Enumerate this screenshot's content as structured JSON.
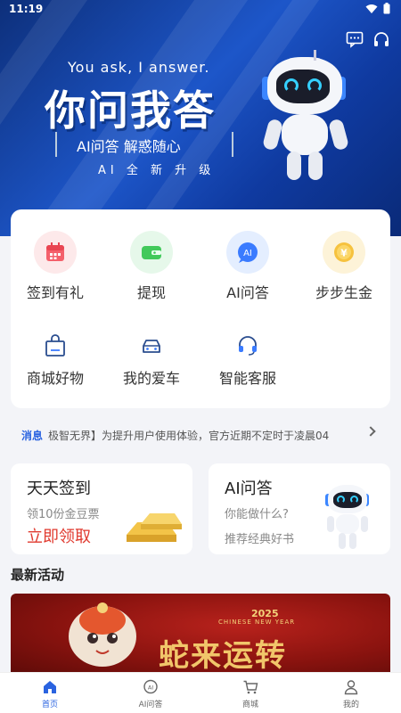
{
  "status_bar": {
    "time": "11:19"
  },
  "hero": {
    "slogan_en": "You ask, I answer.",
    "slogan_cn": "你问我答",
    "sub_title": "AI问答 解惑随心",
    "upgrade": "AI 全 新 升 级"
  },
  "menu": {
    "items": [
      {
        "label": "签到有礼",
        "icon": "calendar-gift-icon"
      },
      {
        "label": "提现",
        "icon": "withdraw-wallet-icon"
      },
      {
        "label": "AI问答",
        "icon": "ai-chat-icon"
      },
      {
        "label": "步步生金",
        "icon": "gold-coin-icon"
      },
      {
        "label": "商城好物",
        "icon": "shopping-bag-icon"
      },
      {
        "label": "我的爱车",
        "icon": "car-icon"
      },
      {
        "label": "智能客服",
        "icon": "headset-icon"
      }
    ]
  },
  "notice": {
    "tag": "消息",
    "text": "极智无界】为提升用户使用体验，官方近期不定时于凌晨04"
  },
  "cards": {
    "sign_in": {
      "title": "天天签到",
      "subtitle": "领10份金豆票",
      "cta": "立即领取"
    },
    "ai": {
      "title": "AI问答",
      "line1": "你能做什么?",
      "line2": "推荐经典好书"
    }
  },
  "activity": {
    "section_title": "最新活动",
    "year": "2025",
    "subtitle": "CHINESE NEW YEAR",
    "title": "蛇来运转"
  },
  "bottom_nav": {
    "items": [
      {
        "label": "首页",
        "icon": "home-icon",
        "active": true
      },
      {
        "label": "AI问答",
        "icon": "ai-chat-icon",
        "active": false
      },
      {
        "label": "商城",
        "icon": "cart-icon",
        "active": false
      },
      {
        "label": "我的",
        "icon": "user-icon",
        "active": false
      }
    ]
  },
  "colors": {
    "accent": "#2a63e0",
    "cta_red": "#e03a2f",
    "hero_blue": "#1d56c9"
  }
}
